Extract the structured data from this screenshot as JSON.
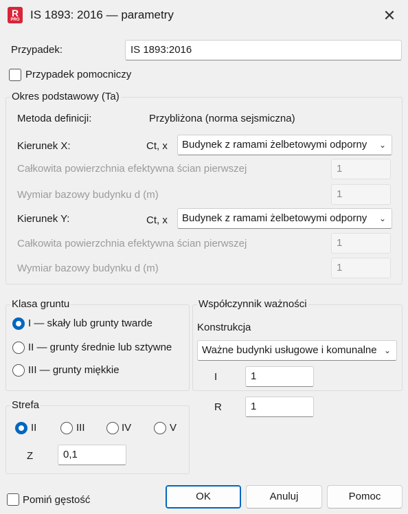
{
  "window": {
    "title": "IS 1893: 2016 — parametry",
    "icon_letter": "R",
    "icon_badge": "PRO",
    "close_glyph": "✕"
  },
  "case": {
    "label": "Przypadek:",
    "value": "IS 1893:2016",
    "aux_label": "Przypadek pomocniczy",
    "aux_checked": false
  },
  "period": {
    "legend": "Okres podstawowy (Ta)",
    "method_label": "Metoda definicji:",
    "method_value": "Przybliżona (norma sejsmiczna)",
    "x": {
      "label": "Kierunek X:",
      "ct_label": "Ct, x",
      "combo_value": "Budynek z ramami żelbetowymi odporny",
      "area_label": "Całkowita powierzchnia efektywna ścian pierwszej",
      "area_value": "1",
      "dim_label": "Wymiar bazowy budynku d (m)",
      "dim_value": "1"
    },
    "y": {
      "label": "Kierunek Y:",
      "ct_label": "Ct, x",
      "combo_value": "Budynek z ramami żelbetowymi odporny",
      "area_label": "Całkowita powierzchnia efektywna ścian pierwszej",
      "area_value": "1",
      "dim_label": "Wymiar bazowy budynku d (m)",
      "dim_value": "1"
    }
  },
  "soil": {
    "legend": "Klasa gruntu",
    "options": [
      {
        "label": "I — skały lub grunty twarde",
        "selected": true
      },
      {
        "label": "II — grunty średnie lub sztywne",
        "selected": false
      },
      {
        "label": "III — grunty miękkie",
        "selected": false
      }
    ]
  },
  "importance": {
    "legend": "Współczynnik ważności",
    "construction_label": "Konstrukcja",
    "construction_value": "Ważne budynki usługowe i komunalne",
    "i_label": "I",
    "i_value": "1",
    "r_label": "R",
    "r_value": "1"
  },
  "zone": {
    "legend": "Strefa",
    "options": [
      {
        "label": "II",
        "selected": true
      },
      {
        "label": "III",
        "selected": false
      },
      {
        "label": "IV",
        "selected": false
      },
      {
        "label": "V",
        "selected": false
      }
    ],
    "z_label": "Z",
    "z_value": "0,1"
  },
  "footer": {
    "skip_density_label": "Pomiń gęstość",
    "skip_density_checked": false,
    "ok": "OK",
    "cancel": "Anuluj",
    "help": "Pomoc"
  },
  "colors": {
    "accent": "#0067c0",
    "brand": "#d9243a",
    "background": "#f0f0f0"
  }
}
